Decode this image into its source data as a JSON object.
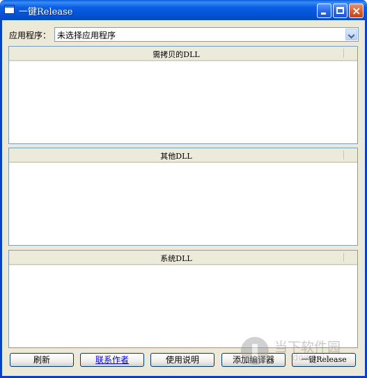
{
  "window": {
    "title": "一键Release",
    "icon": "application-window-icon",
    "controls": {
      "minimize": "minimize-icon",
      "maximize": "maximize-icon",
      "close": "close-icon",
      "close_glyph": "×"
    }
  },
  "app_selector": {
    "label": "应用程序：",
    "selected_value": "未选择应用程序"
  },
  "lists": [
    {
      "header": "需拷贝的DLL",
      "items": []
    },
    {
      "header": "其他DLL",
      "items": []
    },
    {
      "header": "系统DLL",
      "items": []
    }
  ],
  "buttons": {
    "refresh": "刷新",
    "contact_author": "联系作者",
    "instructions": "使用说明",
    "add_compiler": "添加编译器",
    "one_click_release": "一键Release"
  },
  "watermark": {
    "text": "当下软件园",
    "sub": "downxia"
  },
  "colors": {
    "titlebar": "#0553d6",
    "window_border": "#0a3ecb",
    "window_bg": "#ece9d8",
    "link": "#0000ff"
  }
}
